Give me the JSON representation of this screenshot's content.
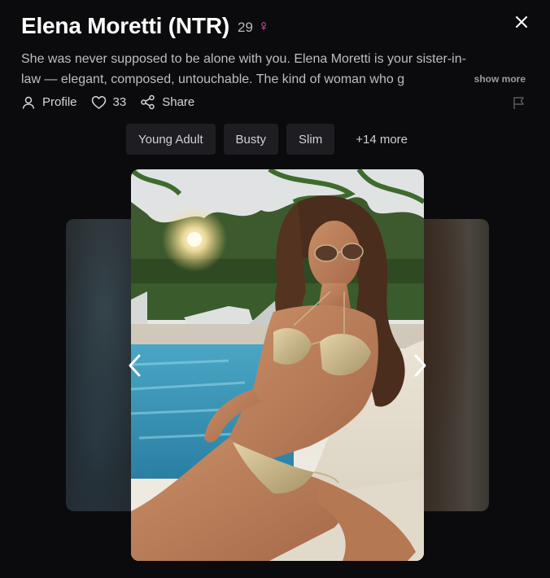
{
  "header": {
    "title": "Elena Moretti (NTR)",
    "age": "29",
    "gender_symbol": "♀",
    "gender_color": "#ff5dc4"
  },
  "description": {
    "line1": "She was never supposed to be alone with you. Elena Moretti is your sister-in-",
    "line2": "law — elegant, composed, untouchable. The kind of woman who g",
    "show_more": "show more"
  },
  "actions": {
    "profile": "Profile",
    "likes": "33",
    "share": "Share"
  },
  "tags": [
    "Young Adult",
    "Busty",
    "Slim"
  ],
  "tags_more": "+14 more",
  "carousel": {
    "main_image_alt": "woman in gold bikini lounging by pool with sunglasses"
  },
  "icons": {
    "close": "close-icon",
    "profile": "user-icon",
    "like": "heart-icon",
    "share": "share-icon",
    "flag": "flag-icon",
    "prev": "chevron-left-icon",
    "next": "chevron-right-icon"
  }
}
